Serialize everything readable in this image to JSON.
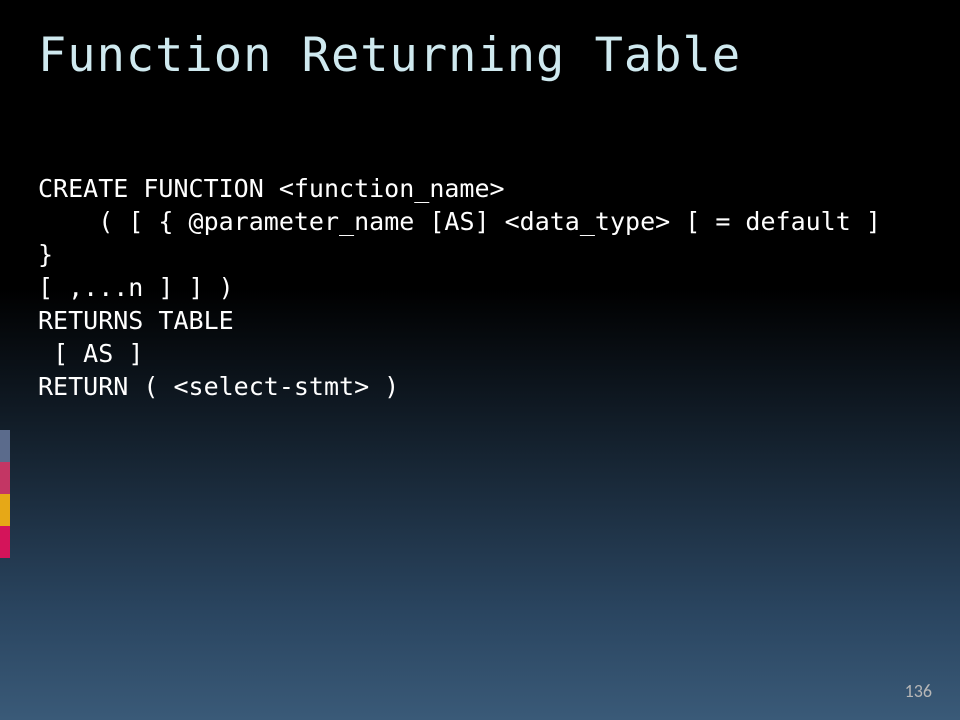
{
  "title": "Function Returning Table",
  "code": {
    "l1": "CREATE FUNCTION <function_name>",
    "l2": "    ( [ { @parameter_name [AS] <data_type> [ = default ] }",
    "l3": "[ ,...n ] ] )",
    "l4": "RETURNS TABLE",
    "l5": " [ AS ]",
    "l6": "RETURN ( <select-stmt> )"
  },
  "page_number": "136"
}
